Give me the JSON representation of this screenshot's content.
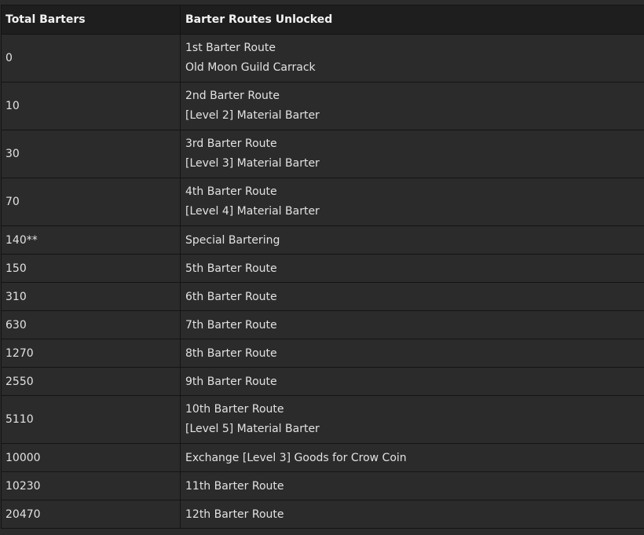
{
  "table": {
    "headers": [
      "Total Barters",
      "Barter Routes Unlocked"
    ],
    "rows": [
      {
        "barters": "0",
        "routes": [
          "1st Barter Route",
          "Old Moon Guild Carrack"
        ]
      },
      {
        "barters": "10",
        "routes": [
          "2nd Barter Route",
          "[Level 2] Material Barter"
        ]
      },
      {
        "barters": "30",
        "routes": [
          "3rd Barter Route",
          "[Level 3] Material Barter"
        ]
      },
      {
        "barters": "70",
        "routes": [
          "4th Barter Route",
          "[Level 4] Material Barter"
        ]
      },
      {
        "barters": "140**",
        "routes": [
          "Special Bartering"
        ]
      },
      {
        "barters": "150",
        "routes": [
          "5th Barter Route"
        ]
      },
      {
        "barters": "310",
        "routes": [
          "6th Barter Route"
        ]
      },
      {
        "barters": "630",
        "routes": [
          "7th Barter Route"
        ]
      },
      {
        "barters": "1270",
        "routes": [
          "8th Barter Route"
        ]
      },
      {
        "barters": "2550",
        "routes": [
          "9th Barter Route"
        ]
      },
      {
        "barters": "5110",
        "routes": [
          "10th Barter Route",
          "[Level 5] Material Barter"
        ]
      },
      {
        "barters": "10000",
        "routes": [
          "Exchange [Level 3] Goods for Crow Coin"
        ]
      },
      {
        "barters": "10230",
        "routes": [
          "11th Barter Route"
        ]
      },
      {
        "barters": "20470",
        "routes": [
          "12th Barter Route"
        ]
      }
    ]
  },
  "colors": {
    "header_bg": "#1e1e1e",
    "row_bg": "#2b2b2b",
    "border": "#141414",
    "text": "#e2e2e2"
  }
}
